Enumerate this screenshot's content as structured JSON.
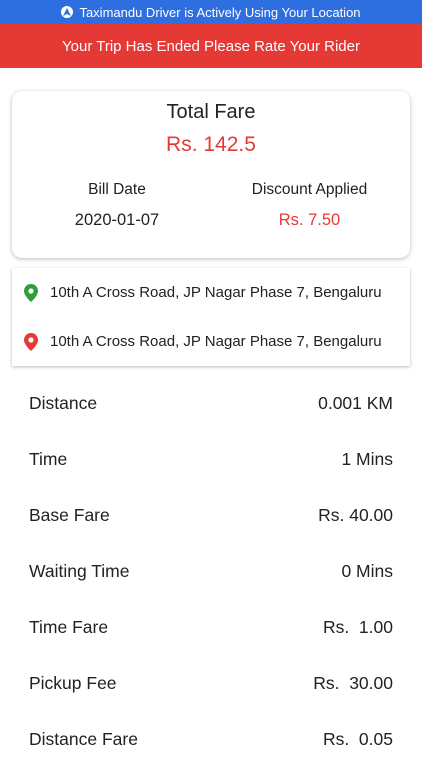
{
  "status_bar": {
    "text": "Taximandu Driver is Actively Using Your Location",
    "icon": "location-arrow-icon"
  },
  "banner": {
    "text": "Your Trip Has Ended Please Rate Your Rider"
  },
  "fare_summary": {
    "title": "Total Fare",
    "total": "Rs. 142.5",
    "bill_date_label": "Bill Date",
    "bill_date": "2020-01-07",
    "discount_label": "Discount Applied",
    "discount": "Rs. 7.50"
  },
  "addresses": {
    "pickup": "10th A Cross Road, JP Nagar Phase 7, Bengaluru",
    "dropoff": "10th A Cross Road, JP Nagar Phase 7, Bengaluru",
    "pickup_icon": "green-location-pin-icon",
    "dropoff_icon": "red-location-pin-icon"
  },
  "fare_breakdown": [
    {
      "label": "Distance",
      "value": "0.001 KM"
    },
    {
      "label": "Time",
      "value": "1 Mins"
    },
    {
      "label": "Base Fare",
      "value": "Rs. 40.00"
    },
    {
      "label": "Waiting Time",
      "value": "0 Mins"
    },
    {
      "label": "Time Fare",
      "value": "Rs.  1.00"
    },
    {
      "label": "Pickup Fee",
      "value": "Rs.  30.00"
    },
    {
      "label": "Distance Fare",
      "value": "Rs.  0.05"
    }
  ],
  "colors": {
    "status_bar": "#2d6fe0",
    "banner": "#e53935",
    "accent_red": "#e53935",
    "pin_green": "#2e9e3a",
    "pin_red": "#e53935"
  }
}
